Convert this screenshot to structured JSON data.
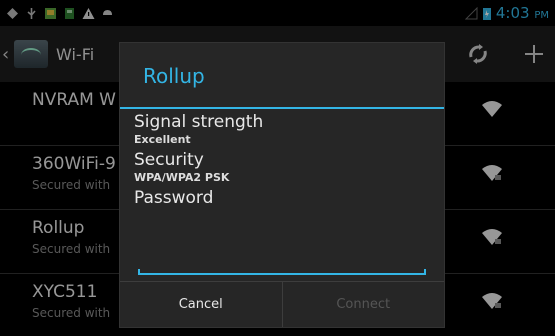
{
  "status_bar": {
    "time": "4:03",
    "ampm": "PM",
    "icons": [
      "usb-debug-icon",
      "usb-icon",
      "photo-icon",
      "sdcard-icon",
      "warning-icon",
      "android-icon",
      "no-signal-icon",
      "battery-icon"
    ]
  },
  "action_bar": {
    "title": "Wi-Fi",
    "actions": [
      "wps-icon",
      "add-network-icon"
    ]
  },
  "networks": [
    {
      "name": "NVRAM W",
      "status": ""
    },
    {
      "name": "360WiFi-9",
      "status": "Secured with"
    },
    {
      "name": "Rollup",
      "status": "Secured with"
    },
    {
      "name": "XYC511",
      "status": "Secured with"
    }
  ],
  "dialog": {
    "title": "Rollup",
    "signal_label": "Signal strength",
    "signal_value": "Excellent",
    "security_label": "Security",
    "security_value": "WPA/WPA2 PSK",
    "password_label": "Password",
    "password_value": "",
    "cancel_label": "Cancel",
    "connect_label": "Connect"
  },
  "colors": {
    "accent": "#33b5e5",
    "dialog_bg": "#262626",
    "actionbar_bg": "#1c1c1c"
  }
}
